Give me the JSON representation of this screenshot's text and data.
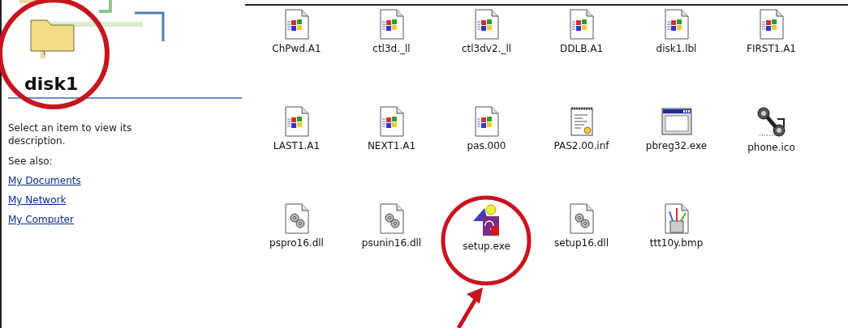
{
  "folder": {
    "title": "disk1",
    "circled": true
  },
  "details": {
    "description": "Select an item to view its description.",
    "see_also_label": "See also:",
    "links": [
      "My Documents",
      "My Network",
      "My Computer"
    ]
  },
  "files": [
    {
      "name": "ChPwd.A1",
      "kind": "app-doc",
      "circled": false
    },
    {
      "name": "ctl3d._ll",
      "kind": "app-doc",
      "circled": false
    },
    {
      "name": "ctl3dv2._ll",
      "kind": "app-doc",
      "circled": false
    },
    {
      "name": "DDLB.A1",
      "kind": "app-doc",
      "circled": false
    },
    {
      "name": "disk1.lbl",
      "kind": "app-doc",
      "circled": false
    },
    {
      "name": "FIRST1.A1",
      "kind": "app-doc",
      "circled": false
    },
    {
      "name": "LAST1.A1",
      "kind": "app-doc",
      "circled": false
    },
    {
      "name": "NEXT1.A1",
      "kind": "app-doc",
      "circled": false
    },
    {
      "name": "pas.000",
      "kind": "app-doc",
      "circled": false
    },
    {
      "name": "PAS2.00.inf",
      "kind": "inf",
      "circled": false
    },
    {
      "name": "pbreg32.exe",
      "kind": "window",
      "circled": false
    },
    {
      "name": "phone.ico",
      "kind": "phone",
      "circled": false
    },
    {
      "name": "pspro16.dll",
      "kind": "dll",
      "circled": false
    },
    {
      "name": "psunin16.dll",
      "kind": "dll",
      "circled": false
    },
    {
      "name": "setup.exe",
      "kind": "setup",
      "circled": true
    },
    {
      "name": "setup16.dll",
      "kind": "dll",
      "circled": false
    },
    {
      "name": "ttt10y.bmp",
      "kind": "bmp",
      "circled": false
    }
  ]
}
